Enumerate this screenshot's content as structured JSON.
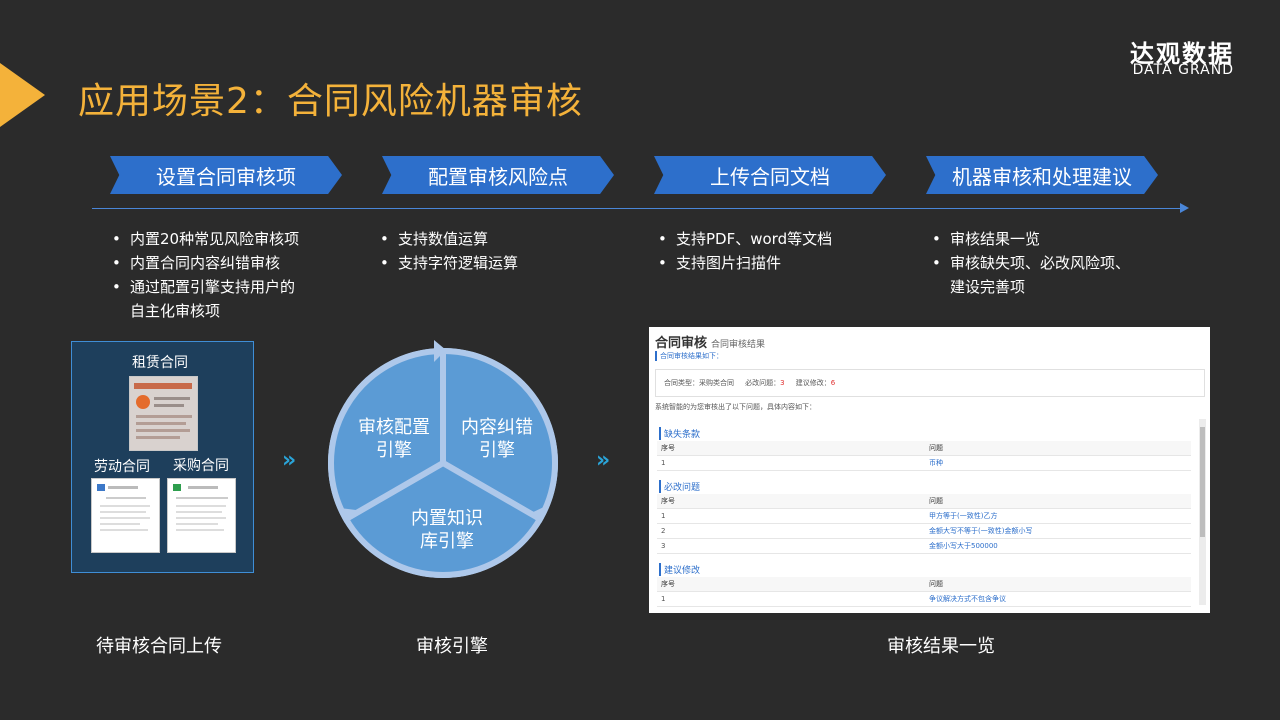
{
  "title": "应用场景2：合同风险机器审核",
  "brand": {
    "cn": "达观数据",
    "en": "DATA GRAND"
  },
  "steps": [
    {
      "label": "设置合同审核项",
      "bullets": [
        "内置20种常见风险审核项",
        "内置合同内容纠错审核",
        "通过配置引擎支持用户的\n自主化审核项"
      ]
    },
    {
      "label": "配置审核风险点",
      "bullets": [
        "支持数值运算",
        "支持字符逻辑运算"
      ]
    },
    {
      "label": "上传合同文档",
      "bullets": [
        "支持PDF、word等文档",
        "支持图片扫描件"
      ]
    },
    {
      "label": "机器审核和处理建议",
      "bullets": [
        "审核结果一览",
        "审核缺失项、必改风险项、\n建设完善项"
      ]
    }
  ],
  "docs": {
    "rent": "租赁合同",
    "labor": "劳动合同",
    "purchase": "采购合同"
  },
  "engine": {
    "seg1": "审核配置\n引擎",
    "seg2": "内容纠错\n引擎",
    "seg3": "内置知识\n库引擎"
  },
  "chevron": "»",
  "captions": {
    "upload": "待审核合同上传",
    "engine": "审核引擎",
    "result": "审核结果一览"
  },
  "result": {
    "title": "合同审核",
    "subtitle": "合同审核结果",
    "sub_label": "合同审核结果如下：",
    "type_label": "合同类型：",
    "type_value": "采购类合同",
    "must_label": "必改问题：",
    "must_value": "3",
    "suggest_label": "建议修改：",
    "suggest_value": "6",
    "note": "系统智能的为您审核出了以下问题，具体内容如下：",
    "col_no": "序号",
    "col_issue": "问题",
    "sections": [
      {
        "name": "缺失条款",
        "rows": [
          [
            "1",
            "币种"
          ]
        ]
      },
      {
        "name": "必改问题",
        "rows": [
          [
            "1",
            "甲方等于(一致性)乙方"
          ],
          [
            "2",
            "金额大写不等于(一致性)金额小写"
          ],
          [
            "3",
            "金额小写大于500000"
          ]
        ]
      },
      {
        "name": "建议修改",
        "rows": [
          [
            "1",
            "争议解决方式不包含争议"
          ]
        ]
      }
    ]
  },
  "colors": {
    "accent": "#f4b23a",
    "step_blue": "#2d6fcb",
    "circle_outer": "#aec8ea",
    "circle_inner": "#5b9bd5",
    "chevron": "#2aa4d8"
  }
}
